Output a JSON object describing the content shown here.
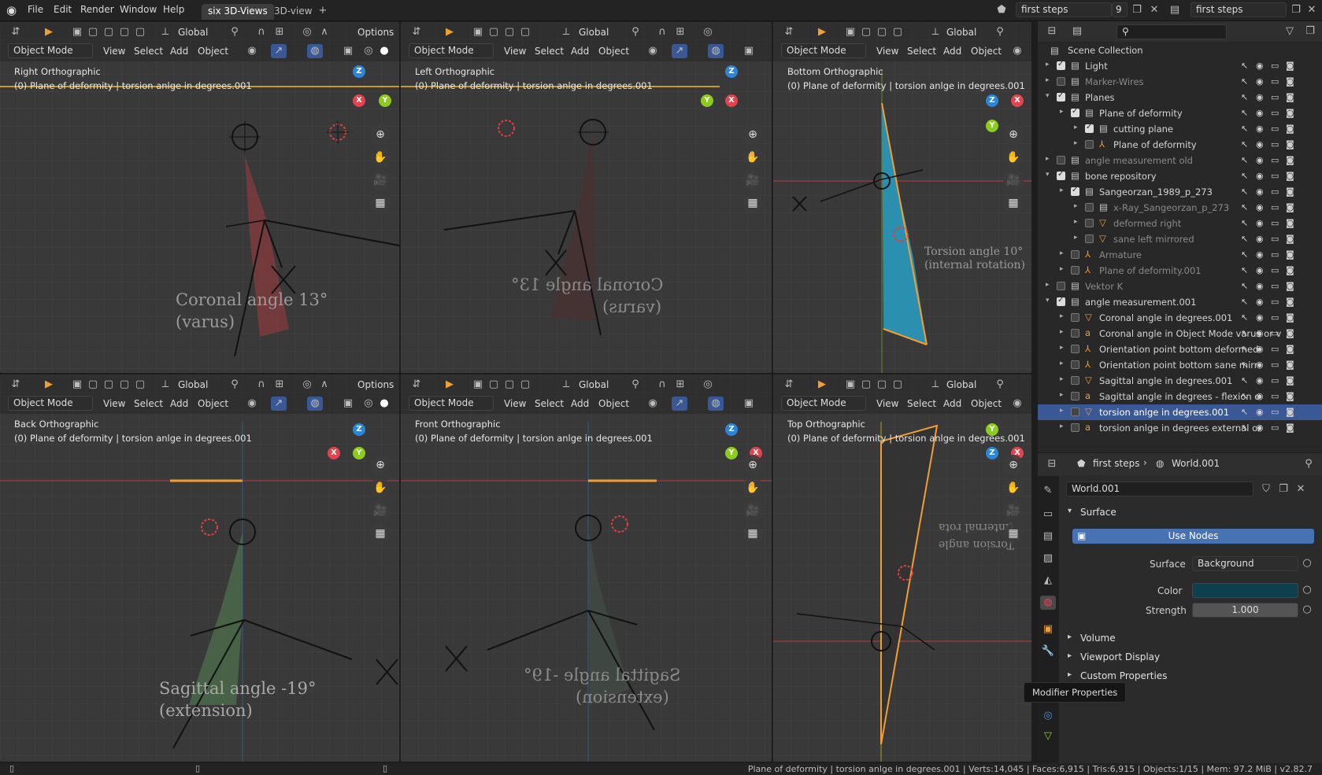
{
  "menu": {
    "items": [
      "File",
      "Edit",
      "Render",
      "Window",
      "Help"
    ],
    "workspaces": [
      "six 3D-Views",
      "3D-view"
    ],
    "scene_name": "first steps",
    "scene_count": "9",
    "view_layer": "first steps"
  },
  "viewport_header": {
    "global": "Global",
    "options": "Options",
    "mode": "Object Mode",
    "menus": [
      "View",
      "Select",
      "Add",
      "Object"
    ]
  },
  "viewports": [
    {
      "title": "Right Orthographic",
      "subtitle": "(0) Plane of deformity | torsion anlge in degrees.001",
      "label1": "Coronal angle 13°",
      "label2": "(varus)"
    },
    {
      "title": "Left Orthographic",
      "subtitle": "(0) Plane of deformity | torsion anlge in degrees.001",
      "label1": "Coronal angle 13°",
      "label2": "(varus)"
    },
    {
      "title": "Bottom Orthographic",
      "subtitle": "(0) Plane of deformity | torsion anlge in degrees.001",
      "label1": "Torsion angle 10°",
      "label2": "(internal rotation)"
    },
    {
      "title": "Back Orthographic",
      "subtitle": "(0) Plane of deformity | torsion anlge in degrees.001",
      "label1": "Sagittal angle -19°",
      "label2": "(extension)"
    },
    {
      "title": "Front Orthographic",
      "subtitle": "(0) Plane of deformity | torsion anlge in degrees.001",
      "label1": "Sagittal angle -19°",
      "label2": "(extension)"
    },
    {
      "title": "Top Orthographic",
      "subtitle": "(0) Plane of deformity | torsion anlge in degrees.001",
      "label1": "Torsion angle",
      "label2": "(internal rota"
    }
  ],
  "outliner": {
    "search_placeholder": "",
    "root": "Scene Collection",
    "rows": [
      {
        "label": "Light",
        "checked": true,
        "active": false,
        "dim": false
      },
      {
        "label": "Marker-Wires",
        "checked": false,
        "active": false,
        "dim": true
      },
      {
        "label": "Planes",
        "checked": true,
        "active": false,
        "dim": false
      },
      {
        "label": "Plane of deformity",
        "checked": true,
        "active": false,
        "dim": false
      },
      {
        "label": "cutting plane",
        "checked": true,
        "active": false,
        "dim": false
      },
      {
        "label": "Plane of deformity",
        "checked": false,
        "active": false,
        "dim": false
      },
      {
        "label": "angle measurement old",
        "checked": false,
        "active": false,
        "dim": true
      },
      {
        "label": "bone repository",
        "checked": true,
        "active": false,
        "dim": false
      },
      {
        "label": "Sangeorzan_1989_p_273",
        "checked": true,
        "active": false,
        "dim": false
      },
      {
        "label": "x-Ray_Sangeorzan_p_273",
        "checked": false,
        "active": false,
        "dim": true
      },
      {
        "label": "deformed right",
        "checked": false,
        "active": false,
        "dim": true
      },
      {
        "label": "sane left mirrored",
        "checked": false,
        "active": false,
        "dim": true
      },
      {
        "label": "Armature",
        "checked": false,
        "active": false,
        "dim": true
      },
      {
        "label": "Plane of deformity.001",
        "checked": false,
        "active": false,
        "dim": true
      },
      {
        "label": "Vektor K",
        "checked": false,
        "active": false,
        "dim": true
      },
      {
        "label": "angle measurement.001",
        "checked": true,
        "active": false,
        "dim": false
      },
      {
        "label": "Coronal angle in degrees.001",
        "checked": false,
        "active": false,
        "dim": false
      },
      {
        "label": "Coronal angle in Object Mode varus or v",
        "checked": false,
        "active": false,
        "dim": false
      },
      {
        "label": "Orientation point bottom deformed",
        "checked": false,
        "active": false,
        "dim": false
      },
      {
        "label": "Orientation point bottom sane mirr",
        "checked": false,
        "active": false,
        "dim": false
      },
      {
        "label": "Sagittal angle in degrees.001",
        "checked": false,
        "active": false,
        "dim": false
      },
      {
        "label": "Sagittal angle in degrees - flexion o",
        "checked": false,
        "active": false,
        "dim": false
      },
      {
        "label": "torsion anlge in degrees.001",
        "checked": false,
        "active": true,
        "dim": false
      },
      {
        "label": "torsion anlge in degrees external or",
        "checked": false,
        "active": false,
        "dim": false
      }
    ]
  },
  "properties": {
    "scene": "first steps",
    "world": "World.001",
    "world_field": "World.001",
    "surface_panel": "Surface",
    "use_nodes": "Use Nodes",
    "surface_label": "Surface",
    "surface_value": "Background",
    "color_label": "Color",
    "color_value": "#0d3f4e",
    "strength_label": "Strength",
    "strength_value": "1.000",
    "volume": "Volume",
    "viewport_display": "Viewport Display",
    "custom_properties": "Custom Properties",
    "tooltip": "Modifier Properties"
  },
  "status": {
    "text": "Plane of deformity | torsion anlge in degrees.001 | Verts:14,045 | Faces:6,915 | Tris:6,915 | Objects:1/15 | Mem: 97.2 MiB | v2.82.7"
  },
  "colors": {
    "x_axis": "#e2434e",
    "y_axis": "#8ccc1e",
    "z_axis": "#2b86d9",
    "selection": "#f29e32",
    "active_row": "#3a5896"
  }
}
